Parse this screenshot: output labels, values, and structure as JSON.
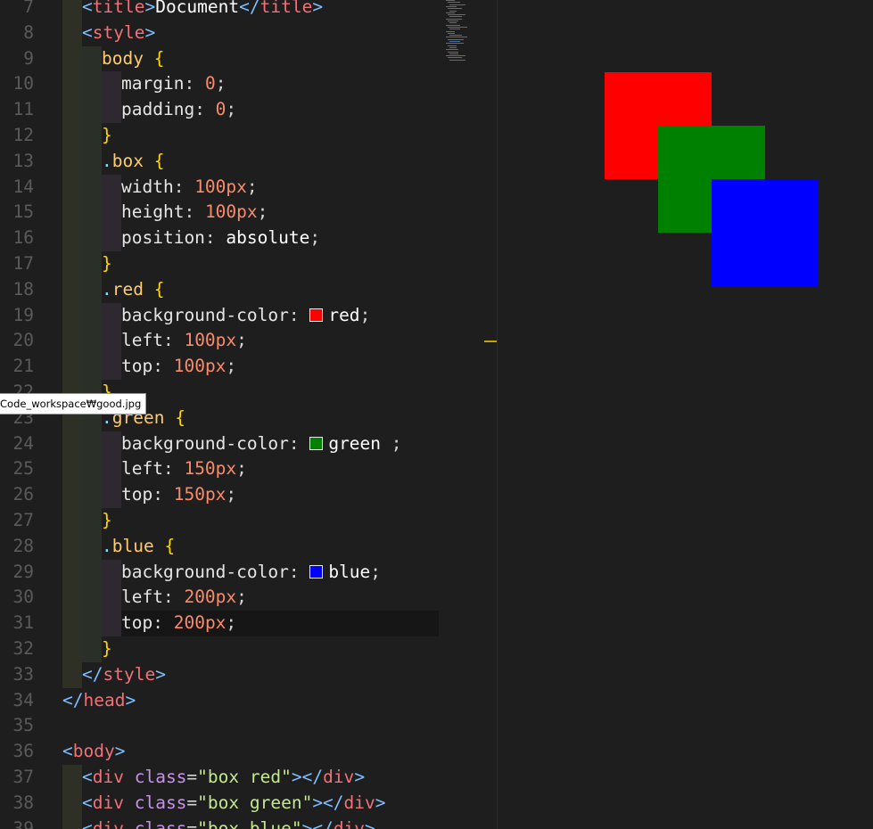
{
  "editor": {
    "lines": [
      {
        "num": "7",
        "code": "<title>Document</title>",
        "toks": [
          [
            "t-br",
            "<"
          ],
          [
            "t-tag",
            "title"
          ],
          [
            "t-br",
            ">"
          ],
          [
            "t-val",
            "Document"
          ],
          [
            "t-br",
            "</"
          ],
          [
            "t-tag",
            "title"
          ],
          [
            "t-br",
            ">"
          ]
        ],
        "indent": 1
      },
      {
        "num": "8",
        "indent": 1,
        "toks": [
          [
            "t-br",
            "<"
          ],
          [
            "t-tag",
            "style"
          ],
          [
            "t-br",
            ">"
          ]
        ]
      },
      {
        "num": "9",
        "indent": 2,
        "toks": [
          [
            "t-sel",
            "body "
          ],
          [
            "t-brace",
            "{"
          ]
        ]
      },
      {
        "num": "10",
        "indent": 3,
        "toks": [
          [
            "t-prop",
            "margin"
          ],
          [
            "t-punc",
            ": "
          ],
          [
            "t-num",
            "0"
          ],
          [
            "t-punc",
            ";"
          ]
        ]
      },
      {
        "num": "11",
        "indent": 3,
        "toks": [
          [
            "t-prop",
            "padding"
          ],
          [
            "t-punc",
            ": "
          ],
          [
            "t-num",
            "0"
          ],
          [
            "t-punc",
            ";"
          ]
        ]
      },
      {
        "num": "12",
        "indent": 2,
        "toks": [
          [
            "t-brace",
            "}"
          ]
        ]
      },
      {
        "num": "13",
        "indent": 2,
        "toks": [
          [
            "t-dot",
            "."
          ],
          [
            "t-sel",
            "box "
          ],
          [
            "t-brace",
            "{"
          ]
        ]
      },
      {
        "num": "14",
        "indent": 3,
        "toks": [
          [
            "t-prop",
            "width"
          ],
          [
            "t-punc",
            ": "
          ],
          [
            "t-num",
            "100px"
          ],
          [
            "t-punc",
            ";"
          ]
        ]
      },
      {
        "num": "15",
        "indent": 3,
        "toks": [
          [
            "t-prop",
            "height"
          ],
          [
            "t-punc",
            ": "
          ],
          [
            "t-num",
            "100px"
          ],
          [
            "t-punc",
            ";"
          ]
        ]
      },
      {
        "num": "16",
        "indent": 3,
        "toks": [
          [
            "t-prop",
            "position"
          ],
          [
            "t-punc",
            ": "
          ],
          [
            "t-val",
            "absolute"
          ],
          [
            "t-punc",
            ";"
          ]
        ]
      },
      {
        "num": "17",
        "indent": 2,
        "toks": [
          [
            "t-brace",
            "}"
          ]
        ]
      },
      {
        "num": "18",
        "indent": 2,
        "toks": [
          [
            "t-dot",
            "."
          ],
          [
            "t-sel",
            "red "
          ],
          [
            "t-brace",
            "{"
          ]
        ]
      },
      {
        "num": "19",
        "indent": 3,
        "toks": [
          [
            "t-prop",
            "background-color"
          ],
          [
            "t-punc",
            ": "
          ],
          [
            "sw",
            "#ff0000"
          ],
          [
            "t-val",
            "red"
          ],
          [
            "t-punc",
            ";"
          ]
        ]
      },
      {
        "num": "20",
        "indent": 3,
        "toks": [
          [
            "t-prop",
            "left"
          ],
          [
            "t-punc",
            ": "
          ],
          [
            "t-num",
            "100px"
          ],
          [
            "t-punc",
            ";"
          ]
        ]
      },
      {
        "num": "21",
        "indent": 3,
        "toks": [
          [
            "t-prop",
            "top"
          ],
          [
            "t-punc",
            ": "
          ],
          [
            "t-num",
            "100px"
          ],
          [
            "t-punc",
            ";"
          ]
        ]
      },
      {
        "num": "22",
        "indent": 2,
        "toks": [
          [
            "t-brace",
            "}"
          ]
        ]
      },
      {
        "num": "23",
        "indent": 2,
        "toks": [
          [
            "t-dot",
            "."
          ],
          [
            "t-sel",
            "green "
          ],
          [
            "t-brace",
            "{"
          ]
        ]
      },
      {
        "num": "24",
        "indent": 3,
        "toks": [
          [
            "t-prop",
            "background-color"
          ],
          [
            "t-punc",
            ": "
          ],
          [
            "sw",
            "#008000"
          ],
          [
            "t-val",
            "green"
          ],
          [
            "t-punc",
            " ;"
          ]
        ]
      },
      {
        "num": "25",
        "indent": 3,
        "toks": [
          [
            "t-prop",
            "left"
          ],
          [
            "t-punc",
            ": "
          ],
          [
            "t-num",
            "150px"
          ],
          [
            "t-punc",
            ";"
          ]
        ]
      },
      {
        "num": "26",
        "indent": 3,
        "toks": [
          [
            "t-prop",
            "top"
          ],
          [
            "t-punc",
            ": "
          ],
          [
            "t-num",
            "150px"
          ],
          [
            "t-punc",
            ";"
          ]
        ]
      },
      {
        "num": "27",
        "indent": 2,
        "toks": [
          [
            "t-brace",
            "}"
          ]
        ]
      },
      {
        "num": "28",
        "indent": 2,
        "toks": [
          [
            "t-dot",
            "."
          ],
          [
            "t-sel",
            "blue "
          ],
          [
            "t-brace",
            "{"
          ]
        ]
      },
      {
        "num": "29",
        "indent": 3,
        "toks": [
          [
            "t-prop",
            "background-color"
          ],
          [
            "t-punc",
            ": "
          ],
          [
            "sw",
            "#0000ff"
          ],
          [
            "t-val",
            "blue"
          ],
          [
            "t-punc",
            ";"
          ]
        ]
      },
      {
        "num": "30",
        "indent": 3,
        "toks": [
          [
            "t-prop",
            "left"
          ],
          [
            "t-punc",
            ": "
          ],
          [
            "t-num",
            "200px"
          ],
          [
            "t-punc",
            ";"
          ]
        ]
      },
      {
        "num": "31",
        "indent": 3,
        "current": true,
        "toks": [
          [
            "t-prop",
            "top"
          ],
          [
            "t-punc",
            ": "
          ],
          [
            "t-num",
            "200px"
          ],
          [
            "t-punc",
            ";"
          ]
        ]
      },
      {
        "num": "32",
        "indent": 2,
        "toks": [
          [
            "t-brace",
            "}"
          ]
        ]
      },
      {
        "num": "33",
        "indent": 1,
        "toks": [
          [
            "t-br",
            "</"
          ],
          [
            "t-tag",
            "style"
          ],
          [
            "t-br",
            ">"
          ]
        ]
      },
      {
        "num": "34",
        "indent": 0,
        "toks": [
          [
            "t-br",
            "</"
          ],
          [
            "t-tag",
            "head"
          ],
          [
            "t-br",
            ">"
          ]
        ]
      },
      {
        "num": "35",
        "indent": 0,
        "toks": []
      },
      {
        "num": "36",
        "indent": 0,
        "toks": [
          [
            "t-br",
            "<"
          ],
          [
            "t-tag",
            "body"
          ],
          [
            "t-br",
            ">"
          ]
        ]
      },
      {
        "num": "37",
        "indent": 1,
        "toks": [
          [
            "t-br",
            "<"
          ],
          [
            "t-tag",
            "div "
          ],
          [
            "t-attr",
            "class"
          ],
          [
            "t-punc",
            "="
          ],
          [
            "t-str",
            "\"box red\""
          ],
          [
            "t-br",
            "></"
          ],
          [
            "t-tag",
            "div"
          ],
          [
            "t-br",
            ">"
          ]
        ]
      },
      {
        "num": "38",
        "indent": 1,
        "toks": [
          [
            "t-br",
            "<"
          ],
          [
            "t-tag",
            "div "
          ],
          [
            "t-attr",
            "class"
          ],
          [
            "t-punc",
            "="
          ],
          [
            "t-str",
            "\"box green\""
          ],
          [
            "t-br",
            "></"
          ],
          [
            "t-tag",
            "div"
          ],
          [
            "t-br",
            ">"
          ]
        ]
      },
      {
        "num": "39",
        "indent": 1,
        "toks": [
          [
            "t-br",
            "<"
          ],
          [
            "t-tag",
            "div "
          ],
          [
            "t-attr",
            "class"
          ],
          [
            "t-punc",
            "="
          ],
          [
            "t-str",
            "\"box blue\""
          ],
          [
            "t-br",
            "></"
          ],
          [
            "t-tag",
            "div"
          ],
          [
            "t-br",
            ">"
          ]
        ]
      }
    ]
  },
  "tooltip": {
    "text": "Code_workspace₩good.jpg"
  },
  "preview": {
    "boxes": [
      {
        "name": "red",
        "color": "#ff0000"
      },
      {
        "name": "green",
        "color": "#008000"
      },
      {
        "name": "blue",
        "color": "#0000ff"
      }
    ]
  }
}
